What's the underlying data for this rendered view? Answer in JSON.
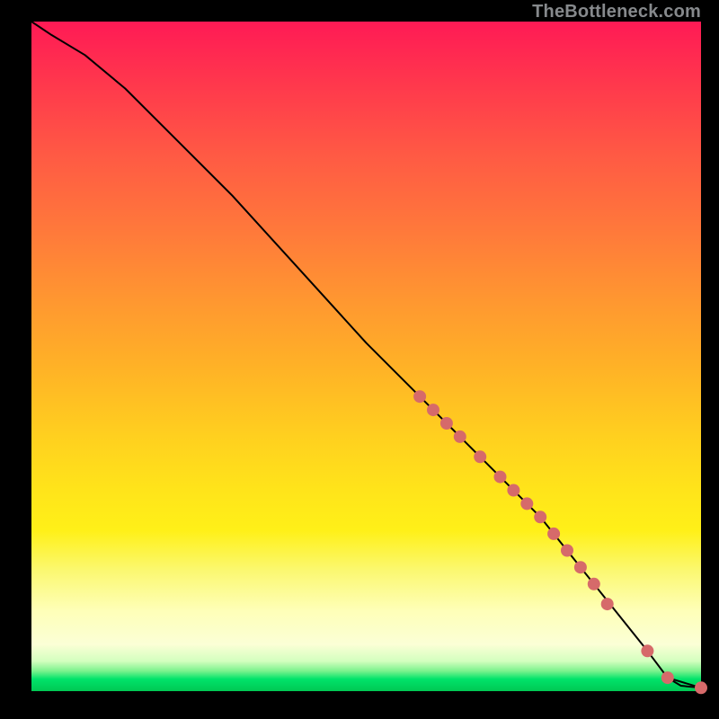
{
  "watermark": "TheBottleneck.com",
  "chart_data": {
    "type": "line",
    "title": "",
    "xlabel": "",
    "ylabel": "",
    "xlim": [
      0,
      100
    ],
    "ylim": [
      0,
      100
    ],
    "grid": false,
    "legend": false,
    "background_gradient": {
      "orientation": "vertical",
      "stops": [
        {
          "pos": 0.0,
          "color": "#ff1a55"
        },
        {
          "pos": 0.2,
          "color": "#ff5a44"
        },
        {
          "pos": 0.42,
          "color": "#ff9830"
        },
        {
          "pos": 0.62,
          "color": "#ffd01f"
        },
        {
          "pos": 0.82,
          "color": "#fbf871"
        },
        {
          "pos": 0.93,
          "color": "#fbffd6"
        },
        {
          "pos": 0.97,
          "color": "#7af28d"
        },
        {
          "pos": 1.0,
          "color": "#00c853"
        }
      ]
    },
    "series": [
      {
        "name": "curve",
        "color": "#000000",
        "stroke_width": 2,
        "x": [
          0,
          3,
          8,
          14,
          22,
          30,
          40,
          50,
          58,
          64,
          70,
          76,
          80,
          84,
          88,
          92,
          95,
          100
        ],
        "y": [
          100,
          98,
          95,
          90,
          82,
          74,
          63,
          52,
          44,
          38,
          32,
          26,
          21,
          16,
          11,
          6,
          2,
          0.5
        ]
      },
      {
        "name": "markers",
        "color": "#d66a6a",
        "marker_radius": 7,
        "x": [
          58,
          60,
          62,
          64,
          67,
          70,
          72,
          74,
          76,
          78,
          80,
          82,
          84,
          86,
          92,
          95,
          100
        ],
        "y": [
          44,
          42,
          40,
          38,
          35,
          32,
          30,
          28,
          26,
          23.5,
          21,
          18.5,
          16,
          13,
          6,
          2,
          0.5
        ]
      }
    ]
  }
}
